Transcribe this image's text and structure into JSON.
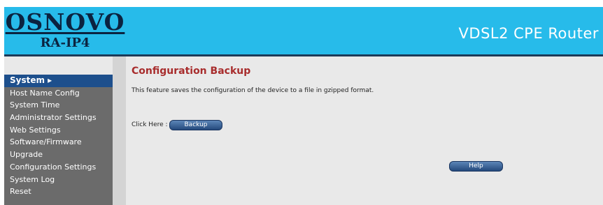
{
  "header": {
    "logo_main": "OSNOVO",
    "logo_sub": "RA-IP4",
    "product_title": "VDSL2 CPE Router"
  },
  "sidebar": {
    "items": [
      {
        "label": "System ▸",
        "active": true
      },
      {
        "label": "Host Name Config"
      },
      {
        "label": "System Time"
      },
      {
        "label": "Administrator Settings"
      },
      {
        "label": "Web Settings"
      },
      {
        "label": "Software/Firmware"
      },
      {
        "label": "Upgrade"
      },
      {
        "label": "Configuration Settings"
      },
      {
        "label": "System Log"
      },
      {
        "label": "Reset"
      }
    ]
  },
  "main": {
    "title": "Configuration Backup",
    "description": "This feature saves the configuration of the device to a file in gzipped format.",
    "click_label": "Click Here :",
    "backup_button": "Backup",
    "help_button": "Help"
  },
  "colors": {
    "header_bg": "#27bbea",
    "menu_bg": "#6b6b6b",
    "menu_active_bg": "#1d4f8c",
    "title_color": "#a82d2d",
    "content_bg": "#e9e9e9"
  }
}
